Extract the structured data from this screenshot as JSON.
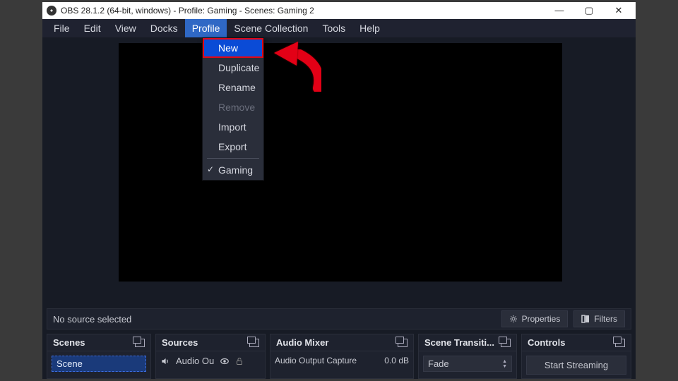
{
  "titlebar": {
    "text": "OBS 28.1.2 (64-bit, windows) - Profile: Gaming - Scenes: Gaming 2"
  },
  "menubar": {
    "items": [
      "File",
      "Edit",
      "View",
      "Docks",
      "Profile",
      "Scene Collection",
      "Tools",
      "Help"
    ],
    "active_index": 4
  },
  "profile_menu": {
    "items": [
      {
        "label": "New",
        "highlighted": true
      },
      {
        "label": "Duplicate"
      },
      {
        "label": "Rename"
      },
      {
        "label": "Remove",
        "disabled": true
      },
      {
        "label": "Import"
      },
      {
        "label": "Export"
      },
      {
        "sep": true
      },
      {
        "label": "Gaming",
        "checked": true
      }
    ]
  },
  "status": {
    "message": "No source selected",
    "properties_btn": "Properties",
    "filters_btn": "Filters"
  },
  "docks": {
    "scenes": {
      "title": "Scenes",
      "item": "Scene"
    },
    "sources": {
      "title": "Sources",
      "item": "Audio Ou"
    },
    "mixer": {
      "title": "Audio Mixer",
      "row_label": "Audio Output Capture",
      "row_value": "0.0 dB"
    },
    "transitions": {
      "title": "Scene Transiti...",
      "value": "Fade"
    },
    "controls": {
      "title": "Controls",
      "btn": "Start Streaming"
    }
  }
}
